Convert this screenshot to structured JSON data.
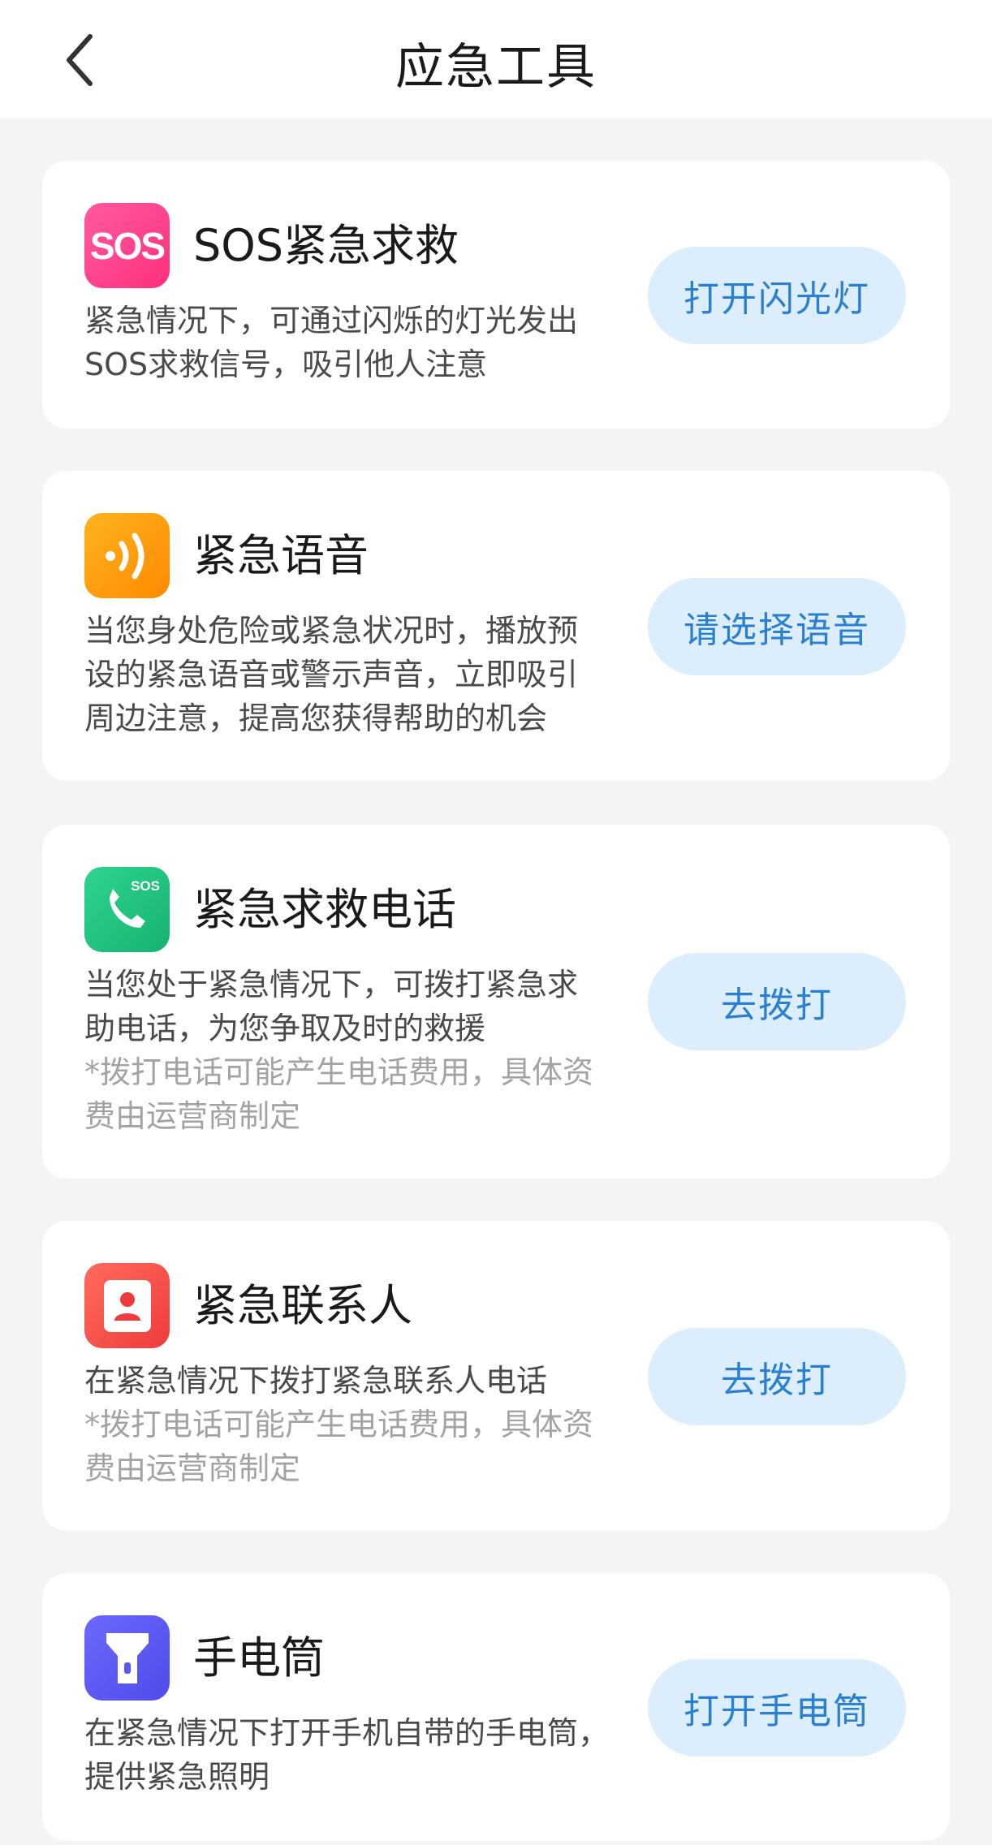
{
  "header": {
    "title": "应急工具",
    "back_icon": "chevron-left-icon"
  },
  "cards": [
    {
      "icon": "sos-icon",
      "icon_text": "SOS",
      "title": "SOS紧急求救",
      "desc_lines": [
        "紧急情况下，可通过闪烁的灯光发出",
        "SOS求救信号，吸引他人注意"
      ],
      "note_lines": [],
      "button": "打开闪光灯"
    },
    {
      "icon": "voice-broadcast-icon",
      "title": "紧急语音",
      "desc_lines": [
        "当您身处危险或紧急状况时，播放预",
        "设的紧急语音或警示声音，立即吸引",
        "周边注意，提高您获得帮助的机会"
      ],
      "note_lines": [],
      "button": "请选择语音"
    },
    {
      "icon": "sos-phone-icon",
      "icon_text": "SOS",
      "title": "紧急求救电话",
      "desc_lines": [
        "当您处于紧急情况下，可拨打紧急求",
        "助电话，为您争取及时的救援"
      ],
      "note_lines": [
        "*拨打电话可能产生电话费用，具体资",
        "费由运营商制定"
      ],
      "button": "去拨打"
    },
    {
      "icon": "contact-card-icon",
      "title": "紧急联系人",
      "desc_lines": [
        "在紧急情况下拨打紧急联系人电话"
      ],
      "note_lines": [
        "*拨打电话可能产生电话费用，具体资",
        "费由运营商制定"
      ],
      "button": "去拨打"
    },
    {
      "icon": "flashlight-icon",
      "title": "手电筒",
      "desc_lines": [
        "在紧急情况下打开手机自带的手电筒，",
        "提供紧急照明"
      ],
      "note_lines": [],
      "button": "打开手电筒"
    }
  ],
  "colors": {
    "background": "#f4f4f6",
    "card": "#ffffff",
    "button_bg": "#dcedfb",
    "button_text": "#2b7fd0",
    "note_text": "#a3a3a3"
  }
}
